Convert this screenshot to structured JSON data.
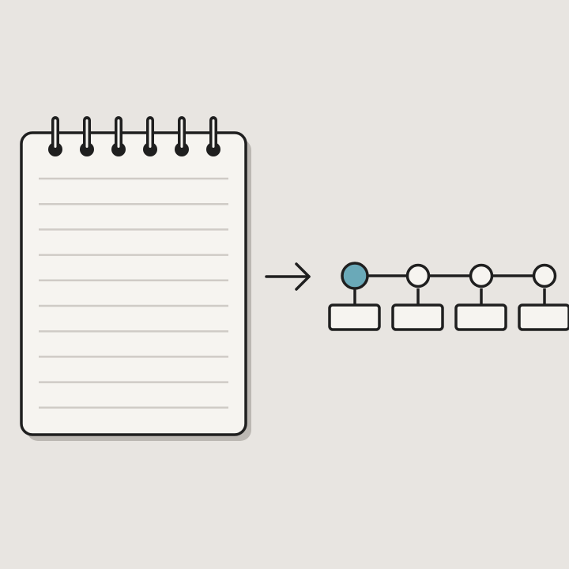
{
  "colors": {
    "background": "#e8e5e1",
    "outline": "#1f1f1f",
    "paper": "#f6f4f0",
    "rule_line": "#cfcbc6",
    "shadow": "#bcb8b3",
    "active_node": "#6aa9b8",
    "inactive_node": "#f6f4f0"
  },
  "notepad": {
    "icon": "spiral-notepad-icon",
    "ring_count": 6,
    "ruled_line_count": 10
  },
  "arrow": {
    "icon": "right-arrow-icon"
  },
  "timeline": {
    "icon": "timeline-icon",
    "nodes": [
      {
        "state": "active"
      },
      {
        "state": "inactive"
      },
      {
        "state": "inactive"
      },
      {
        "state": "inactive"
      }
    ]
  }
}
